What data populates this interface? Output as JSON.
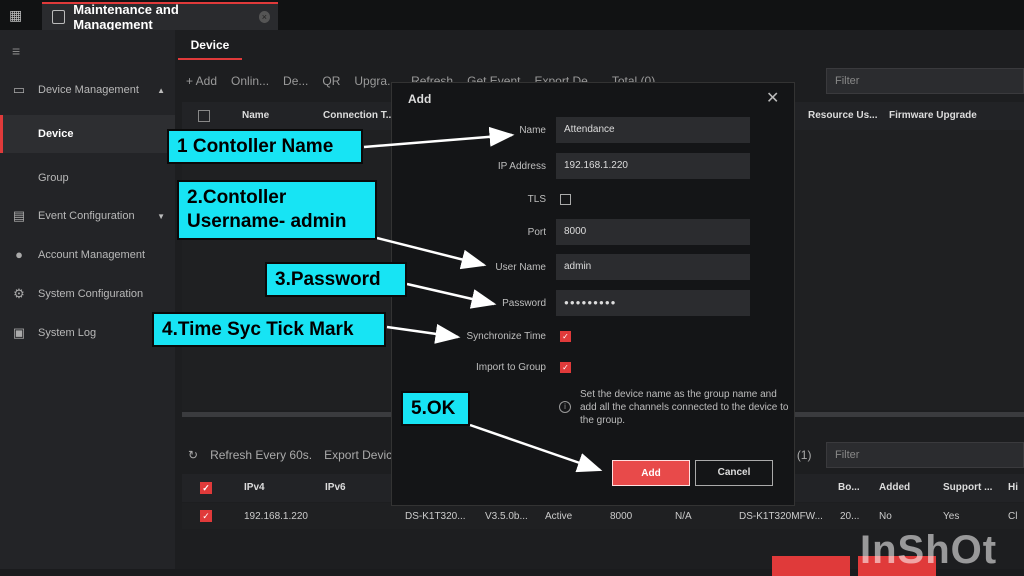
{
  "app": {
    "tab_title": "Maintenance and Management"
  },
  "sidebar": {
    "items": [
      {
        "label": "Device Management",
        "icon": "device-icon"
      },
      {
        "label": "Device"
      },
      {
        "label": "Group"
      },
      {
        "label": "Event Configuration",
        "icon": "event-icon"
      },
      {
        "label": "Account Management",
        "icon": "user-icon"
      },
      {
        "label": "System Configuration",
        "icon": "gear-icon"
      },
      {
        "label": "System Log",
        "icon": "log-icon"
      }
    ]
  },
  "main": {
    "tab": "Device",
    "toolbar": [
      "+ Add",
      "Onlin...",
      "De...",
      "QR",
      "Upgra...",
      "Refresh",
      "Get Event",
      "Export De...",
      "Total (0)"
    ],
    "filter_placeholder": "Filter",
    "columns": [
      "Name",
      "Connection T...",
      "Resource Us...",
      "Firmware Upgrade"
    ]
  },
  "online": {
    "refresh": "Refresh Every 60s.",
    "export": "Export Device",
    "count": "l (1)",
    "filter_placeholder": "Filter",
    "columns": [
      "IPv4",
      "IPv6",
      "Bo...",
      "Added",
      "Support ...",
      "Hi"
    ],
    "row": [
      "192.168.1.220",
      "DS-K1T320...",
      "V3.5.0b...",
      "Active",
      "8000",
      "N/A",
      "DS-K1T320MFW...",
      "20...",
      "No",
      "Yes",
      "Cl"
    ]
  },
  "dialog": {
    "title": "Add",
    "fields": {
      "name_label": "Name",
      "name_value": "Attendance",
      "ip_label": "IP Address",
      "ip_value": "192.168.1.220",
      "tls_label": "TLS",
      "port_label": "Port",
      "port_value": "8000",
      "user_label": "User Name",
      "user_value": "admin",
      "pass_label": "Password",
      "pass_value": "●●●●●●●●●",
      "sync_label": "Synchronize Time",
      "import_label": "Import to Group"
    },
    "info": "Set the device name as the group name and add all the channels connected to the device to the group.",
    "add_label": "Add",
    "cancel_label": "Cancel"
  },
  "callouts": {
    "c1": "1 Contoller Name",
    "c2a": "2.Contoller",
    "c2b": "Username- admin",
    "c3": "3.Password",
    "c4": "4.Time Syc Tick Mark",
    "c5": "5.OK"
  },
  "watermark": "InShOt",
  "colors": {
    "accent": "#e03a3a",
    "callout": "#17e4f4"
  }
}
